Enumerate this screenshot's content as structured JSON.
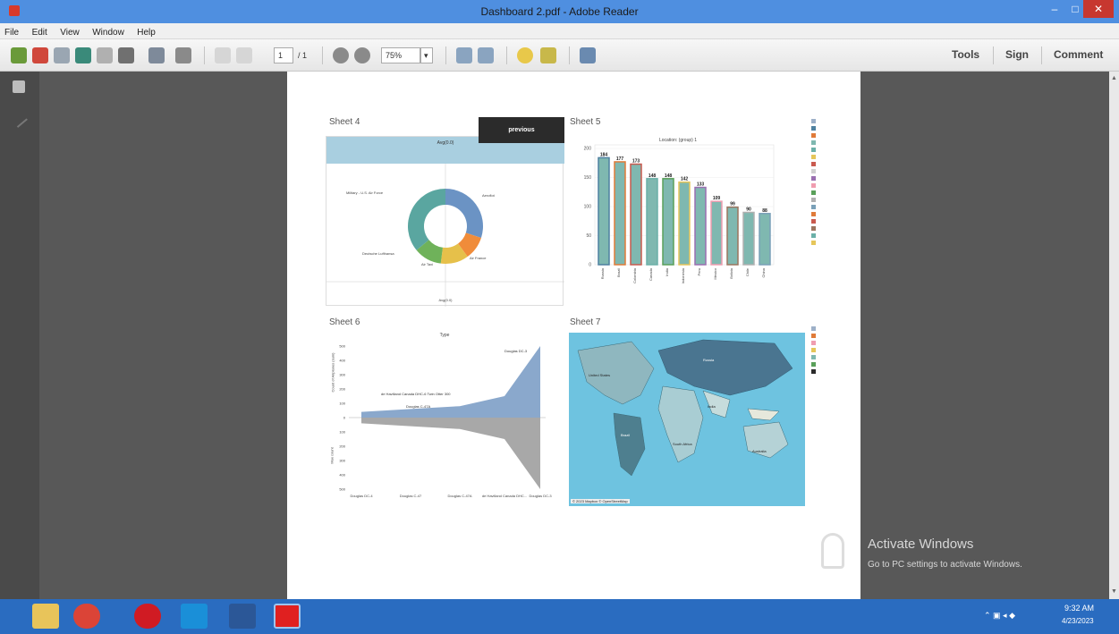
{
  "window": {
    "title": "Dashboard 2.pdf - Adobe Reader",
    "minimize": "–",
    "maximize": "□",
    "close": "✕"
  },
  "menu": [
    "File",
    "Edit",
    "View",
    "Window",
    "Help"
  ],
  "toolbar": {
    "page_current": "1",
    "page_total": "/ 1",
    "zoom": "75%",
    "tools": "Tools",
    "sign": "Sign",
    "comment": "Comment"
  },
  "page": {
    "sheet4": {
      "title": "Sheet 4",
      "header": "Avg(0.0)",
      "footer": "Avg(0.0)",
      "button": "previous",
      "labels": {
        "military": "Military - U.S. Air Force",
        "aeroflot": "Aeroflot",
        "deutsche": "Deutsche Lufthansa",
        "airfrance": "Air France",
        "airtaxi": "Air Taxi"
      }
    },
    "sheet5": {
      "title": "Sheet 5",
      "header": "Location: (group) 1"
    },
    "sheet6": {
      "title": "Sheet 6",
      "top_label": "Type",
      "ylabel_top": "Count of Airplanes (sum)",
      "ylabel_bottom": "Max count",
      "annotations": {
        "a1": "Douglas DC-3",
        "a2": "de Havilland Canada DHC-6 Twin Otter 300",
        "a3": "Douglas C-47A"
      }
    },
    "sheet7": {
      "title": "Sheet 7",
      "attribution": "© 2023 Mapbox © OpenStreetMap",
      "labels": {
        "russia": "Russia",
        "us": "United States",
        "brazil": "Brazil",
        "saf": "South Africa",
        "aus": "Australia",
        "india": "India"
      }
    }
  },
  "watermark": {
    "line1": "Activate Windows",
    "line2": "Go to PC settings to activate Windows."
  },
  "tray": {
    "time": "9:32 AM",
    "date": "4/23/2023"
  },
  "chart_data": [
    {
      "type": "pie",
      "title": "Sheet 4",
      "series": [
        {
          "name": "Aeroflot",
          "value": 30,
          "color": "#6b93c4"
        },
        {
          "name": "Air France",
          "value": 10,
          "color": "#f08c3a"
        },
        {
          "name": "Air Taxi",
          "value": 12,
          "color": "#e6c04a"
        },
        {
          "name": "Deutsche Lufthansa",
          "value": 12,
          "color": "#6fb25a"
        },
        {
          "name": "Military - U.S. Air Force",
          "value": 36,
          "color": "#5aa6a0"
        }
      ]
    },
    {
      "type": "bar",
      "title": "Sheet 5",
      "ylim": [
        0,
        200
      ],
      "categories": [
        "Russia",
        "Brazil",
        "Colombia",
        "Canada",
        "India",
        "Indonesia",
        "Peru",
        "Mexico",
        "Bolivia",
        "Chile",
        "China"
      ],
      "values": [
        184,
        177,
        173,
        148,
        148,
        142,
        133,
        109,
        99,
        90,
        88
      ],
      "colors": [
        "#4f81a0",
        "#e07b39",
        "#c95a4f",
        "#6bb0a8",
        "#5aa05a",
        "#e6c65a",
        "#9a6fb0",
        "#f09db0",
        "#9c755f",
        "#b0b0b0",
        "#7aa0b8"
      ]
    },
    {
      "type": "area",
      "title": "Sheet 6",
      "x": [
        "Douglas DC-4",
        "Douglas C-47",
        "Douglas C-47A",
        "de Havilland Canada DHC...",
        "Douglas DC-3"
      ],
      "series": [
        {
          "name": "Count of Airplanes (sum)",
          "values": [
            40,
            60,
            80,
            150,
            500
          ]
        },
        {
          "name": "Max count",
          "values": [
            -40,
            -60,
            -80,
            -150,
            -500
          ]
        }
      ]
    }
  ]
}
